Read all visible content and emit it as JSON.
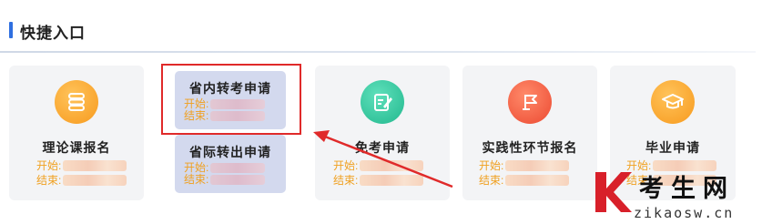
{
  "section": {
    "title": "快捷入口"
  },
  "date_labels": {
    "start": "开始:",
    "end": "结束:"
  },
  "cards": [
    {
      "title": "理论课报名",
      "icon": "stack-icon",
      "color": "#f7a22a"
    },
    {
      "title": "省内转考申请",
      "icon": "none"
    },
    {
      "title": "免考申请",
      "icon": "edit-note-icon",
      "color": "#2ec49c"
    },
    {
      "title": "实践性环节报名",
      "icon": "flag-icon",
      "color": "#f05a3e"
    },
    {
      "title": "毕业申请",
      "icon": "graduation-cap-icon",
      "color": "#f7a22a"
    }
  ],
  "mini_cards": [
    {
      "title": "省内转考申请"
    },
    {
      "title": "省际转出申请"
    }
  ],
  "watermark": {
    "text": "考生网",
    "url": "zikaosw.cn"
  },
  "colors": {
    "accent": "#2f6fe0",
    "date_text": "#f0a020",
    "highlight": "#e02a2a"
  }
}
